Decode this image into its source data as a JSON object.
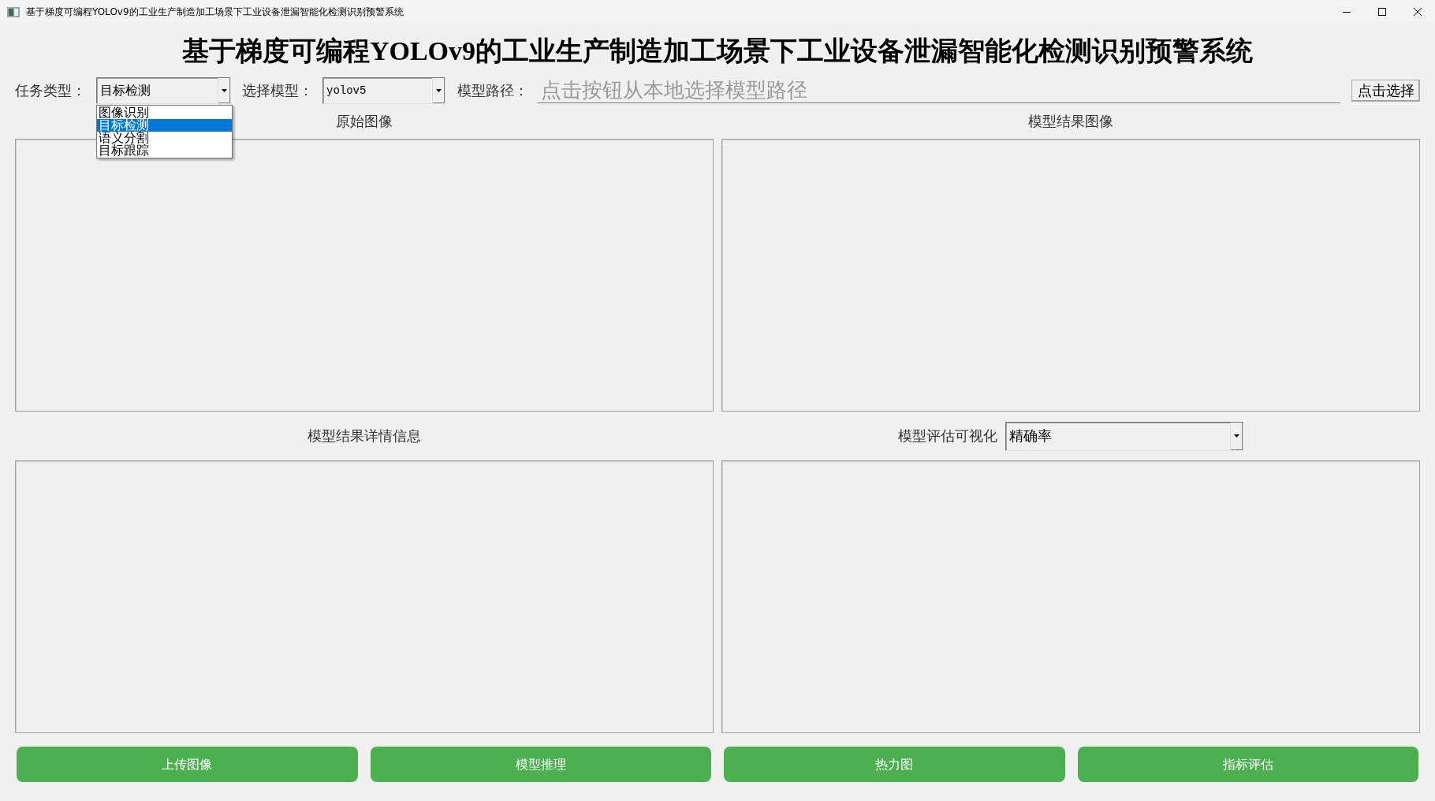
{
  "window": {
    "title": "基于梯度可编程YOLOv9的工业生产制造加工场景下工业设备泄漏智能化检测识别预警系统"
  },
  "heading": "基于梯度可编程YOLOv9的工业生产制造加工场景下工业设备泄漏智能化检测识别预警系统",
  "task_type": {
    "label": "任务类型：",
    "value": "目标检测",
    "expanded": true,
    "options": [
      {
        "label": "图像识别",
        "selected": false
      },
      {
        "label": "目标检测",
        "selected": true
      },
      {
        "label": "语义分割",
        "selected": false
      },
      {
        "label": "目标跟踪",
        "selected": false
      }
    ]
  },
  "model_select": {
    "label": "选择模型：",
    "value": "yolov5"
  },
  "model_path": {
    "label": "模型路径：",
    "placeholder": "点击按钮从本地选择模型路径",
    "button": "点击选择"
  },
  "panels": [
    {
      "title": "原始图像"
    },
    {
      "title": "模型结果图像"
    },
    {
      "title": "模型结果详情信息"
    },
    {
      "title": "模型评估可视化",
      "select_value": "精确率"
    }
  ],
  "buttons": [
    "上传图像",
    "模型推理",
    "热力图",
    "指标评估"
  ]
}
